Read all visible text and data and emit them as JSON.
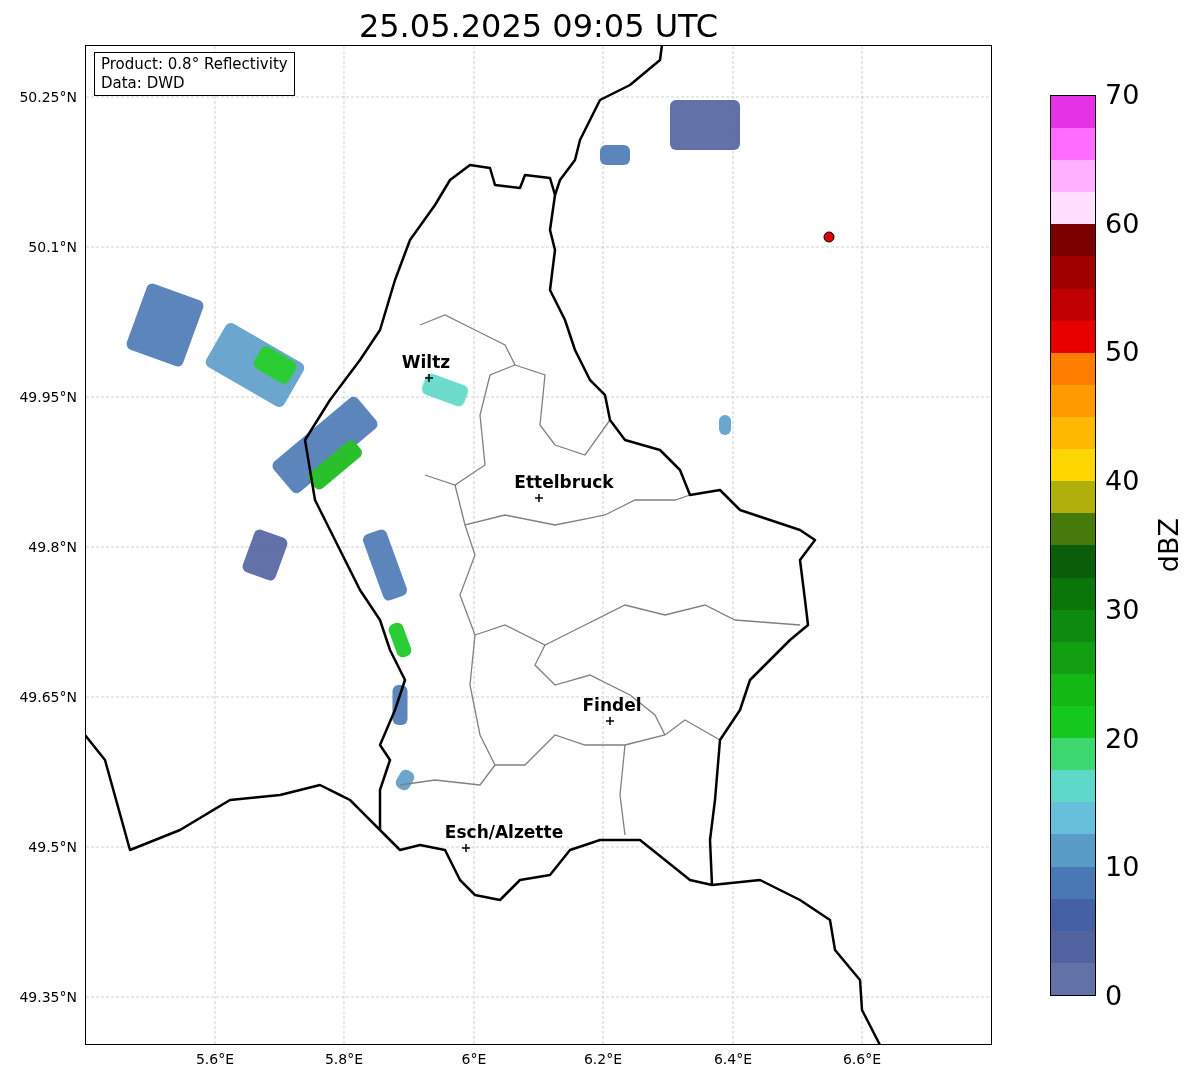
{
  "title": "25.05.2025 09:05 UTC",
  "info_box": [
    "Product: 0.8° Reflectivity",
    "Data: DWD"
  ],
  "x_ticks": [
    "5.6°E",
    "5.8°E",
    "6°E",
    "6.2°E",
    "6.4°E",
    "6.6°E"
  ],
  "y_ticks": [
    "50.25°N",
    "50.1°N",
    "49.95°N",
    "49.8°N",
    "49.65°N",
    "49.5°N",
    "49.35°N"
  ],
  "cities": [
    {
      "label": "Wiltz"
    },
    {
      "label": "Ettelbruck"
    },
    {
      "label": "Findel"
    },
    {
      "label": "Esch/Alzette"
    }
  ],
  "colorbar": {
    "label": "dBZ",
    "ticks": [
      "70",
      "60",
      "50",
      "40",
      "30",
      "20",
      "10",
      "0"
    ],
    "bins": [
      {
        "color": "#6272a8"
      },
      {
        "color": "#5163a0"
      },
      {
        "color": "#4560a4"
      },
      {
        "color": "#4a78b4"
      },
      {
        "color": "#5a9cc8"
      },
      {
        "color": "#66c0dc"
      },
      {
        "color": "#5ed8c8"
      },
      {
        "color": "#3ed870"
      },
      {
        "color": "#14c81e"
      },
      {
        "color": "#14b814"
      },
      {
        "color": "#12a012"
      },
      {
        "color": "#0e8a0e"
      },
      {
        "color": "#0a760a"
      },
      {
        "color": "#0a5e0a"
      },
      {
        "color": "#467a0a"
      },
      {
        "color": "#b0b00a"
      },
      {
        "color": "#ffd700"
      },
      {
        "color": "#ffb800"
      },
      {
        "color": "#ff9a00"
      },
      {
        "color": "#ff7e00"
      },
      {
        "color": "#e60000"
      },
      {
        "color": "#c00000"
      },
      {
        "color": "#a00000"
      },
      {
        "color": "#7a0000"
      },
      {
        "color": "#ffe0ff"
      },
      {
        "color": "#ffb0ff"
      },
      {
        "color": "#ff6cff"
      },
      {
        "color": "#e632e6"
      }
    ]
  }
}
